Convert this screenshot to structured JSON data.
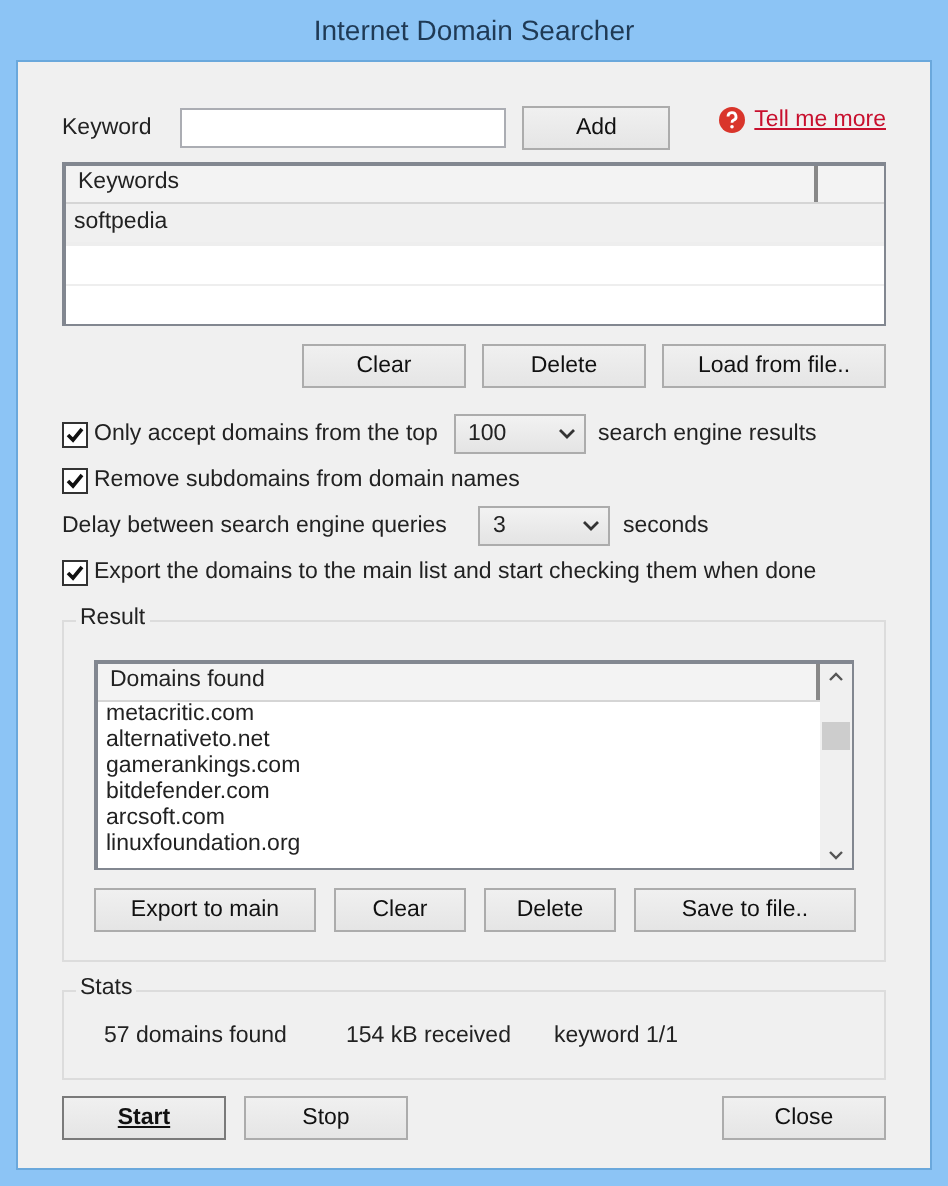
{
  "window": {
    "title": "Internet Domain Searcher"
  },
  "keyword": {
    "label": "Keyword",
    "add_button": "Add",
    "help_link": "Tell me more"
  },
  "keywords_list": {
    "columns": [
      "Keywords"
    ],
    "rows": [
      {
        "text": "softpedia",
        "selected": true
      }
    ]
  },
  "keyword_buttons": [
    "Clear",
    "Delete",
    "Load from file.."
  ],
  "options": [
    {
      "kind": "check",
      "checked": true,
      "label": "Only accept domains from the top",
      "combo": "100",
      "suffix": "search engine  results"
    },
    {
      "kind": "check",
      "checked": true,
      "label": "Remove subdomains from domain names"
    },
    {
      "kind": "combo",
      "label": "Delay between search engine queries",
      "combo": "3",
      "suffix": "seconds"
    },
    {
      "kind": "check",
      "checked": true,
      "label": "Export the domains to the main list and start checking them when done"
    }
  ],
  "result": {
    "title": "Result",
    "columns": [
      "Domains found"
    ],
    "rows": [
      {
        "text": "metacritic.com",
        "selected": false
      },
      {
        "text": "alternativeto.net",
        "selected": false
      },
      {
        "text": "gamerankings.com",
        "selected": false
      },
      {
        "text": "bitdefender.com",
        "selected": false
      },
      {
        "text": "arcsoft.com",
        "selected": false
      },
      {
        "text": "linuxfoundation.org",
        "selected": false
      }
    ],
    "buttons": [
      "Export to main",
      "Clear",
      "Delete",
      "Save to file.."
    ]
  },
  "stats": {
    "title": "Stats",
    "items": [
      "57 domains found",
      "154 kB received",
      "keyword 1/1"
    ]
  },
  "bottom_buttons": [
    {
      "label": "Start",
      "default": true
    },
    {
      "label": "Stop",
      "default": false
    },
    {
      "label": "Close",
      "default": false
    }
  ]
}
